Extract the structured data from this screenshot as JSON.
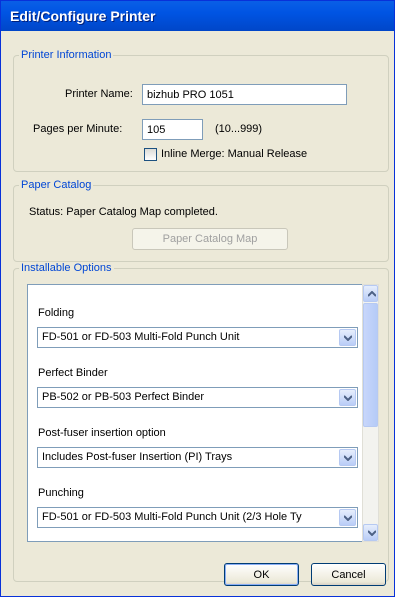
{
  "window": {
    "title": "Edit/Configure Printer"
  },
  "printer_info": {
    "legend": "Printer Information",
    "name_label": "Printer Name:",
    "name_value": "bizhub PRO 1051",
    "ppm_label": "Pages per Minute:",
    "ppm_value": "105",
    "ppm_range": "(10...999)",
    "inline_merge_label": "Inline Merge: Manual Release",
    "inline_merge_checked": false
  },
  "paper_catalog": {
    "legend": "Paper Catalog",
    "status": "Status:  Paper Catalog Map completed.",
    "button_label": "Paper Catalog Map"
  },
  "installable_options": {
    "legend": "Installable Options",
    "options": [
      {
        "label": "Folding",
        "value": "FD-501 or FD-503 Multi-Fold Punch Unit"
      },
      {
        "label": "Perfect Binder",
        "value": "PB-502 or PB-503 Perfect Binder"
      },
      {
        "label": "Post-fuser insertion option",
        "value": "Includes Post-fuser Insertion (PI) Trays"
      },
      {
        "label": "Punching",
        "value": "FD-501 or FD-503 Multi-Fold Punch Unit (2/3 Hole Ty"
      }
    ]
  },
  "buttons": {
    "ok": "OK",
    "cancel": "Cancel"
  },
  "icons": {
    "dropdown": "chevron-down-icon",
    "scroll_up": "chevron-up-icon",
    "scroll_down": "chevron-down-icon"
  }
}
